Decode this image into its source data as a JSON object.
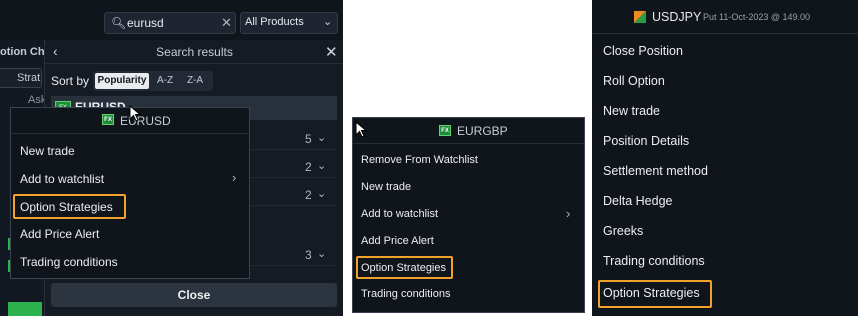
{
  "panelA": {
    "search_value": "eurusd",
    "products_label": "All Products",
    "bg_text_1": "otion Ch",
    "bg_text_2": "Strat",
    "bg_text_3": "Ask",
    "results_title": "Search results",
    "sort_label": "Sort by",
    "sort_tabs": [
      "Popularity",
      "A-Z",
      "Z-A"
    ],
    "result_row_name": "EURUSD",
    "counts": [
      "5",
      "2",
      "2",
      "3"
    ],
    "close_button": "Close",
    "menu": {
      "title": "EURUSD",
      "items": [
        "New trade",
        "Add to watchlist",
        "Option Strategies",
        "Add Price Alert",
        "Trading conditions"
      ]
    }
  },
  "panelB": {
    "title": "EURGBP",
    "items": [
      "Remove From Watchlist",
      "New trade",
      "Add to watchlist",
      "Add Price Alert",
      "Option Strategies",
      "Trading conditions"
    ]
  },
  "panelC": {
    "symbol": "USDJPY",
    "subtitle": "Put 11-Oct-2023 @ 149.00",
    "items": [
      "Close Position",
      "Roll Option",
      "New trade",
      "Position Details",
      "Settlement method",
      "Delta Hedge",
      "Greeks",
      "Trading conditions",
      "Option Strategies"
    ]
  },
  "badge_text": "FX",
  "colors": {
    "highlight": "#f2a12a",
    "background": "#10141b",
    "fx_green": "#1e8c3c"
  }
}
